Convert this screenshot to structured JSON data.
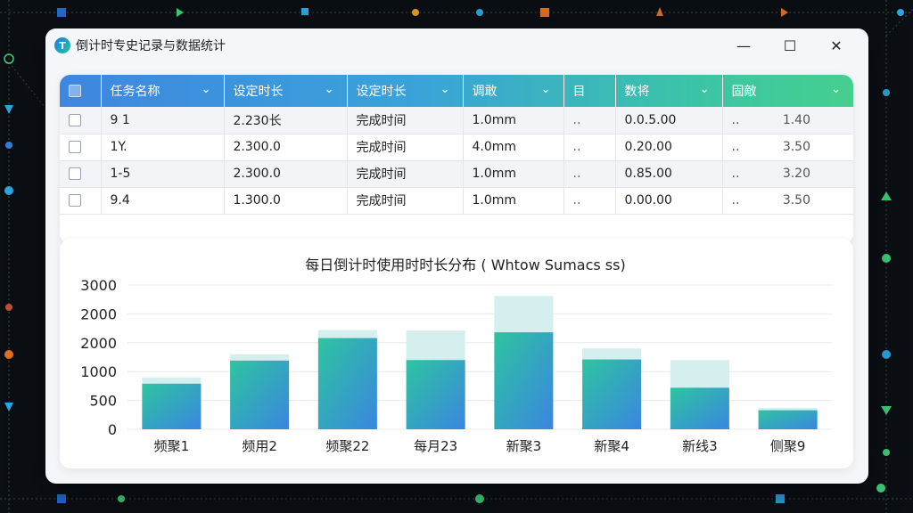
{
  "window": {
    "title": "倒计时专史记录与数据统计",
    "minimize_glyph": "—",
    "maximize_glyph": "☐",
    "close_glyph": "✕"
  },
  "table": {
    "headers": [
      "任务名称",
      "设定时长",
      "设定时长",
      "调敢",
      "目",
      "数将",
      "固敵"
    ],
    "rows": [
      {
        "name": "9 1",
        "set": "2.230长",
        "mode": "完成时间",
        "dur": "1.0mm",
        "dot": "..",
        "num": "0.0.5.00",
        "dot2": "..",
        "val": "1.40"
      },
      {
        "name": "1Y.",
        "set": "2.300.0",
        "mode": "完成时间",
        "dur": "4.0mm",
        "dot": "..",
        "num": "0.20.00",
        "dot2": "..",
        "val": "3.50"
      },
      {
        "name": "1-5",
        "set": "2.300.0",
        "mode": "完成时间",
        "dur": "1.0mm",
        "dot": "..",
        "num": "0.85.00",
        "dot2": "..",
        "val": "3.20"
      },
      {
        "name": "9.4",
        "set": "1.300.0",
        "mode": "完成时间",
        "dur": "1.0mm",
        "dot": "..",
        "num": "0.00.00",
        "dot2": "..",
        "val": "3.50"
      }
    ],
    "header_gradient": [
      "#3f86e0",
      "#46cf8e"
    ]
  },
  "chart_data": {
    "type": "bar",
    "title": "每日倒计时使用时时长分布 ( Whtow Sumacs ss)",
    "y_tick_labels": [
      "0",
      "500",
      "1000",
      "2000",
      "2000",
      "3000"
    ],
    "categories": [
      "频聚1",
      "频用2",
      "频聚22",
      "每月23",
      "新聚3",
      "新聚4",
      "新线3",
      "侧聚9"
    ],
    "series": [
      {
        "values": [
          790,
          1190,
          1580,
          1200,
          1680,
          1210,
          720,
          330
        ]
      },
      {
        "values": [
          900,
          1300,
          1720,
          1710,
          2310,
          1400,
          1200,
          370
        ]
      }
    ],
    "ylim": [
      0,
      2500
    ],
    "grid": true,
    "colors": {
      "bar_top": "#2ec4a0",
      "bar_bottom": "#3a86e0",
      "ghost": "#d5eeee"
    }
  }
}
